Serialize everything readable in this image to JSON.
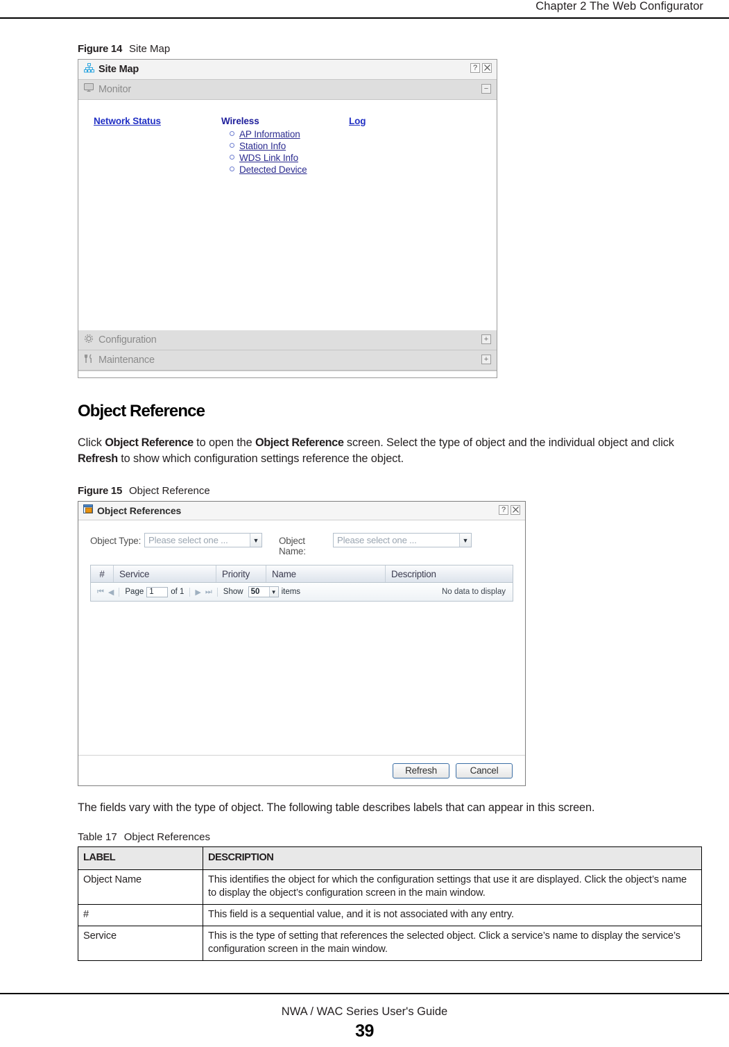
{
  "page": {
    "header_text": "Chapter 2 The Web Configurator",
    "footer_text": "NWA / WAC Series User's Guide",
    "page_number": "39"
  },
  "figure14": {
    "number": "Figure 14",
    "title": "Site Map",
    "window": {
      "title": "Site Map",
      "title_icon": "sitemap-icon",
      "help_button": "?",
      "close_button": "×",
      "sections": [
        {
          "label": "Monitor",
          "icon": "monitor-icon",
          "toggle": "−",
          "expanded": true
        },
        {
          "label": "Configuration",
          "icon": "gear-icon",
          "toggle": "+",
          "expanded": false
        },
        {
          "label": "Maintenance",
          "icon": "tools-icon",
          "toggle": "+",
          "expanded": false
        }
      ],
      "monitor_columns": [
        {
          "heading": "Network Status",
          "heading_is_link": true,
          "items": []
        },
        {
          "heading": "Wireless",
          "heading_is_link": false,
          "items": [
            "AP Information",
            "Station Info",
            "WDS Link Info",
            "Detected Device"
          ]
        },
        {
          "heading": "Log",
          "heading_is_link": true,
          "items": []
        }
      ]
    }
  },
  "section": {
    "heading": "Object Reference",
    "paragraph": {
      "p1": "Click ",
      "b1": "Object Reference",
      "p2": " to open the ",
      "b2": "Object Reference",
      "p3": " screen. Select the type of object and the individual object and click ",
      "b3": "Refresh",
      "p4": " to show which configuration settings reference the object."
    }
  },
  "figure15": {
    "number": "Figure 15",
    "title": "Object Reference",
    "window": {
      "title": "Object References",
      "title_icon": "object-window-icon",
      "help_button": "?",
      "close_button": "×",
      "fields": [
        {
          "label": "Object Type:",
          "value": "Please select one ..."
        },
        {
          "label": "Object Name:",
          "value": "Please select one ..."
        }
      ],
      "grid": {
        "columns": [
          "#",
          "Service",
          "Priority",
          "Name",
          "Description"
        ],
        "rows": [],
        "empty_text": "No data to display"
      },
      "pager": {
        "first_icon": "⏮",
        "prev_icon": "◀",
        "page_label": "Page",
        "page_value": "1",
        "of_label": "of 1",
        "next_icon": "▶",
        "last_icon": "⏭",
        "show_label": "Show",
        "show_value": "50",
        "items_label": "items"
      },
      "buttons": [
        {
          "label": "Refresh",
          "name": "refresh-button"
        },
        {
          "label": "Cancel",
          "name": "cancel-button"
        }
      ]
    }
  },
  "after_figure_text": "The fields vary with the type of object. The following table describes labels that can appear in this screen.",
  "table17": {
    "caption_number": "Table 17",
    "caption_title": "Object References",
    "headers": [
      "LABEL",
      "DESCRIPTION"
    ],
    "rows": [
      {
        "label": "Object Name",
        "description": "This identifies the object for which the configuration settings that use it are displayed. Click the object’s name to display the object’s configuration screen in the main window."
      },
      {
        "label": "#",
        "description": "This field is a sequential value, and it is not associated with any entry."
      },
      {
        "label": "Service",
        "description": "This is the type of setting that references the selected object. Click a service’s name to display the service’s configuration screen in the main window."
      }
    ]
  }
}
